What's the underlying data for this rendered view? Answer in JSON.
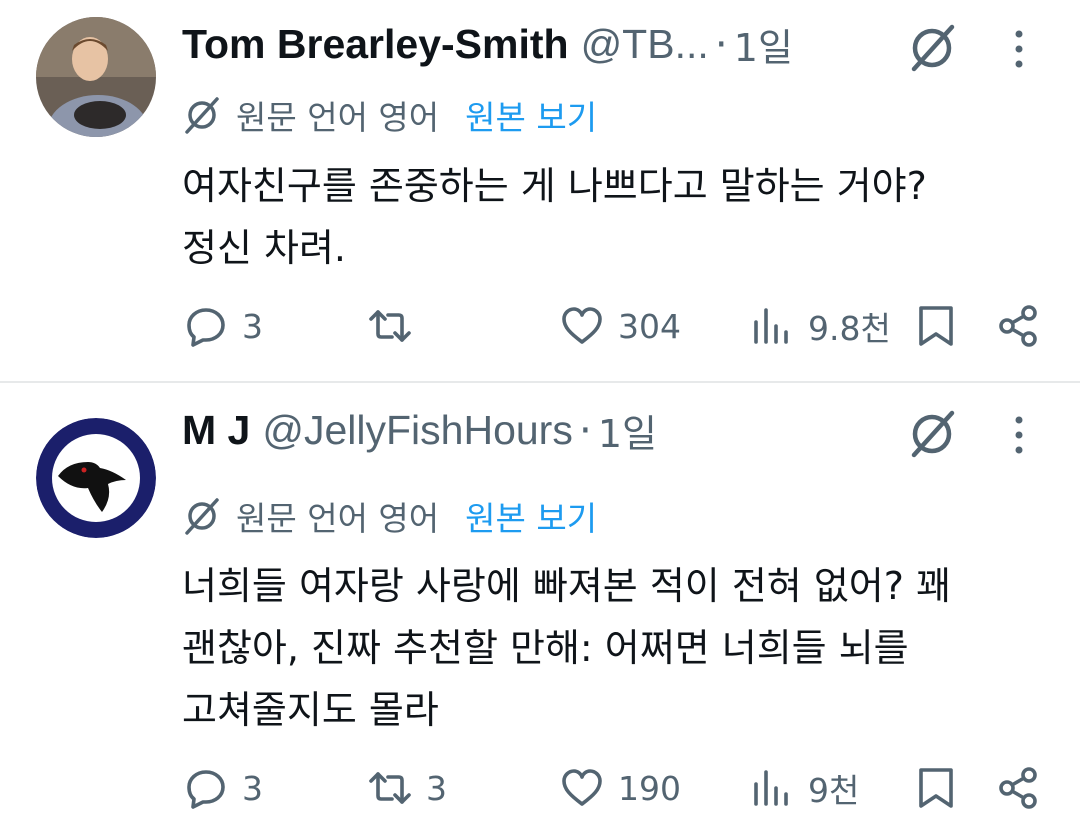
{
  "tweets": [
    {
      "display_name": "Tom Brearley-Smith",
      "handle": "@TB...",
      "separator": "·",
      "time": "1일",
      "translate": {
        "original_language": "원문 언어 영어",
        "show_original": "원본 보기"
      },
      "text": "여자친구를 존중하는 게 나쁘다고 말하는 거야?\n정신 차려.",
      "stats": {
        "replies": "3",
        "reposts": "",
        "likes": "304",
        "views": "9.8천"
      }
    },
    {
      "display_name": "M J",
      "handle": "@JellyFishHours",
      "separator": "·",
      "time": "1일",
      "translate": {
        "original_language": "원문 언어 영어",
        "show_original": "원본 보기"
      },
      "text": "너희들 여자랑 사랑에 빠져본 적이 전혀 없어? 꽤\n괜찮아, 진짜 추천할 만해: 어쩌면 너희들 뇌를\n고쳐줄지도 몰라",
      "stats": {
        "replies": "3",
        "reposts": "3",
        "likes": "190",
        "views": "9천"
      }
    }
  ],
  "colors": {
    "text": "#0f1419",
    "secondary": "#536471",
    "link": "#1d9bf0",
    "divider": "#e7e9ea"
  },
  "icons": [
    "grok-icon",
    "more-icon",
    "translate-icon",
    "reply-icon",
    "repost-icon",
    "like-icon",
    "views-icon",
    "bookmark-icon",
    "share-icon"
  ]
}
